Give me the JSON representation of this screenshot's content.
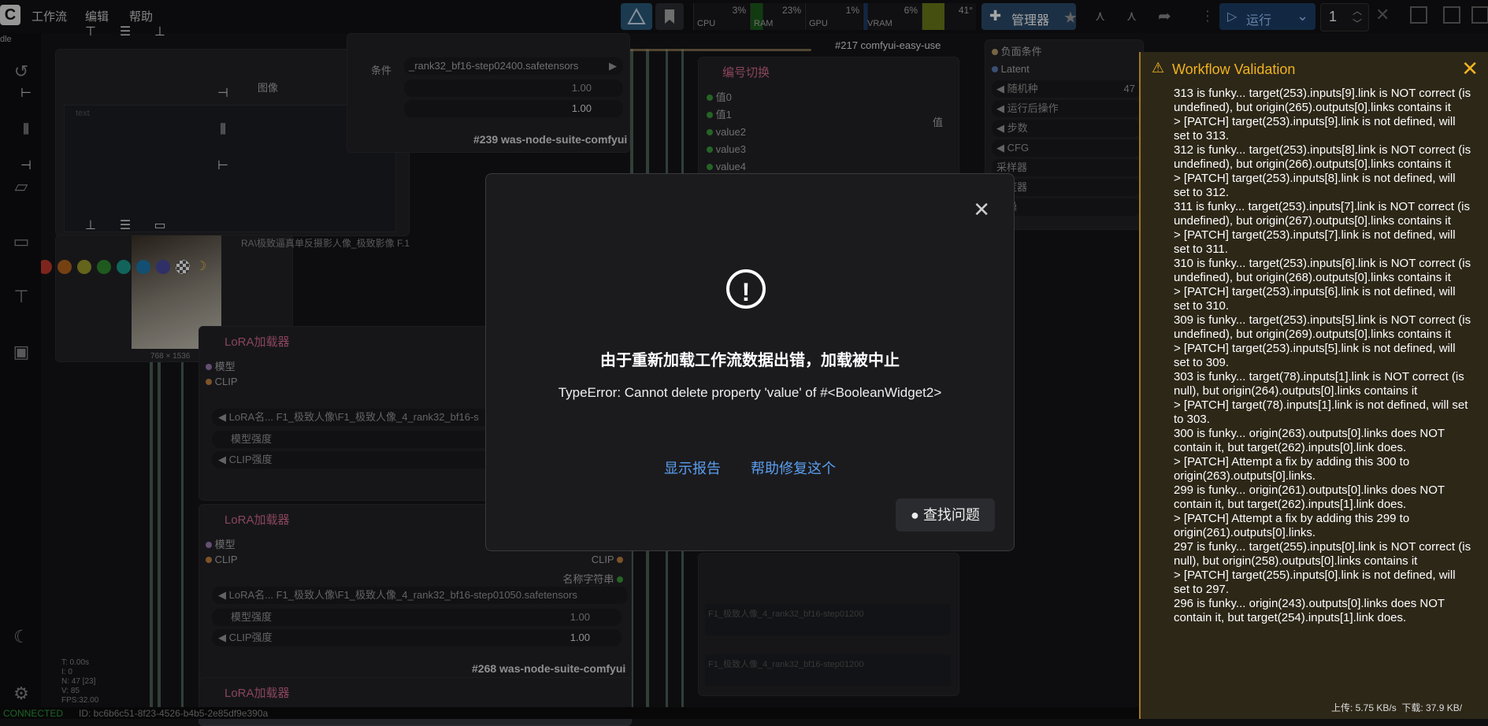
{
  "topbar": {
    "logo": "C",
    "menu": [
      "工作流",
      "编辑",
      "帮助"
    ],
    "metrics": [
      {
        "label": "CPU",
        "pct": "3%"
      },
      {
        "label": "RAM",
        "pct": "23%"
      },
      {
        "label": "GPU",
        "pct": "1%"
      },
      {
        "label": "VRAM",
        "pct": "6%"
      },
      {
        "label": "Temp",
        "pct": "41°"
      }
    ],
    "manager_label": "管理器",
    "run_label": "运行",
    "run_count": "1"
  },
  "canvas": {
    "idle_label": "dle",
    "top_file": "_rank32_bf16-step02400.safetensors",
    "cond_label": "条件",
    "image_label": "图像",
    "val_1": "1.00",
    "val_2": "1.00",
    "text_placeholder": "text",
    "node_tag_1": "#239 was-node-suite-comfyui",
    "node_tag_2": "#268 was-node-suite-comfyui",
    "easy_use_tag": "#217 comfyui-easy-use",
    "lora_prompt": "RA\\极致逼真单反摄影人像_极致影像 F.1",
    "image_size": "768 × 1536",
    "switch_node": {
      "title": "编号切换",
      "inputs": [
        "值0",
        "值1",
        "value2",
        "value3",
        "value4"
      ],
      "output": "值"
    },
    "right_node": {
      "items": [
        "负面条件",
        "Latent",
        "随机种",
        "运行后操作",
        "步数",
        "CFG",
        "采样器",
        "调度器",
        "降噪"
      ],
      "seed_value": "47"
    },
    "lora_nodes": [
      {
        "title": "LoRA加载器",
        "inputs": [
          "模型",
          "CLIP"
        ],
        "lora_name": "LoRA名... F1_极致人像\\F1_极致人像_4_rank32_bf16-s",
        "model_strength": "模型强度",
        "clip_strength": "CLIP强度"
      },
      {
        "title": "LoRA加载器",
        "inputs": [
          "模型",
          "CLIP"
        ],
        "outputs": [
          "CLIP",
          "名称字符串"
        ],
        "lora_name": "LoRA名... F1_极致人像\\F1_极致人像_4_rank32_bf16-step01050.safetensors",
        "model_strength": "模型强度",
        "model_value": "1.00",
        "clip_strength": "CLIP强度",
        "clip_value": "1.00"
      },
      {
        "title": "LoRA加载器"
      }
    ],
    "text_preview_1": "F1_极致人像_4_rank32_bf16-step01200",
    "text_preview_2": "F1_极致人像_4_rank32_bf16-step01200",
    "stats": [
      "T: 0.00s",
      "I: 0",
      "N: 47 [23]",
      "V: 85",
      "FPS:32.00"
    ],
    "palette": [
      "#c0392b",
      "#b5651d",
      "#9a9a2a",
      "#2e8b2e",
      "#1d9a8a",
      "#1d7ab0",
      "#4a4aa0"
    ]
  },
  "status": {
    "connected": "CONNECTED",
    "id": "ID: bc6b6c51-8f23-4526-b4b5-2e85df9e390a"
  },
  "network": {
    "upload": "上传: 5.75 KB/s",
    "download": "下载: 37.9 KB/"
  },
  "dialog": {
    "title": "由于重新加载工作流数据出错，加载被中止",
    "error": "TypeError: Cannot delete property 'value' of #<BooleanWidget2>",
    "show_report": "显示报告",
    "help_fix": "帮助修复这个",
    "find_issue": "查找问题"
  },
  "validation": {
    "title": "Workflow Validation",
    "log": [
      "313 is funky... target(253).inputs[9].link is NOT correct (is undefined), but origin(265).outputs[0].links contains it",
      "> [PATCH] target(253).inputs[9].link is not defined, will set to 313.",
      "312 is funky... target(253).inputs[8].link is NOT correct (is undefined), but origin(266).outputs[0].links contains it",
      "> [PATCH] target(253).inputs[8].link is not defined, will set to 312.",
      "311 is funky... target(253).inputs[7].link is NOT correct (is undefined), but origin(267).outputs[0].links contains it",
      "> [PATCH] target(253).inputs[7].link is not defined, will set to 311.",
      "310 is funky... target(253).inputs[6].link is NOT correct (is undefined), but origin(268).outputs[0].links contains it",
      "> [PATCH] target(253).inputs[6].link is not defined, will set to 310.",
      "309 is funky... target(253).inputs[5].link is NOT correct (is undefined), but origin(269).outputs[0].links contains it",
      "> [PATCH] target(253).inputs[5].link is not defined, will set to 309.",
      "303 is funky... target(78).inputs[1].link is NOT correct (is null), but origin(264).outputs[0].links contains it",
      "> [PATCH] target(78).inputs[1].link is not defined, will set to 303.",
      "300 is funky... origin(263).outputs[0].links does NOT contain it, but target(262).inputs[0].link does.",
      "> [PATCH] Attempt a fix by adding this 300 to origin(263).outputs[0].links.",
      "299 is funky... origin(261).outputs[0].links does NOT contain it, but target(262).inputs[1].link does.",
      "> [PATCH] Attempt a fix by adding this 299 to origin(261).outputs[0].links.",
      "297 is funky... target(255).inputs[0].link is NOT correct (is null), but origin(258).outputs[0].links contains it",
      "> [PATCH] target(255).inputs[0].link is not defined, will set to 297.",
      "296 is funky... origin(243).outputs[0].links does NOT contain it, but target(254).inputs[1].link does."
    ]
  },
  "colors": {
    "accent_link": "#5b9ff0",
    "warning": "#f0b320",
    "node_title": "#d46a8a"
  }
}
